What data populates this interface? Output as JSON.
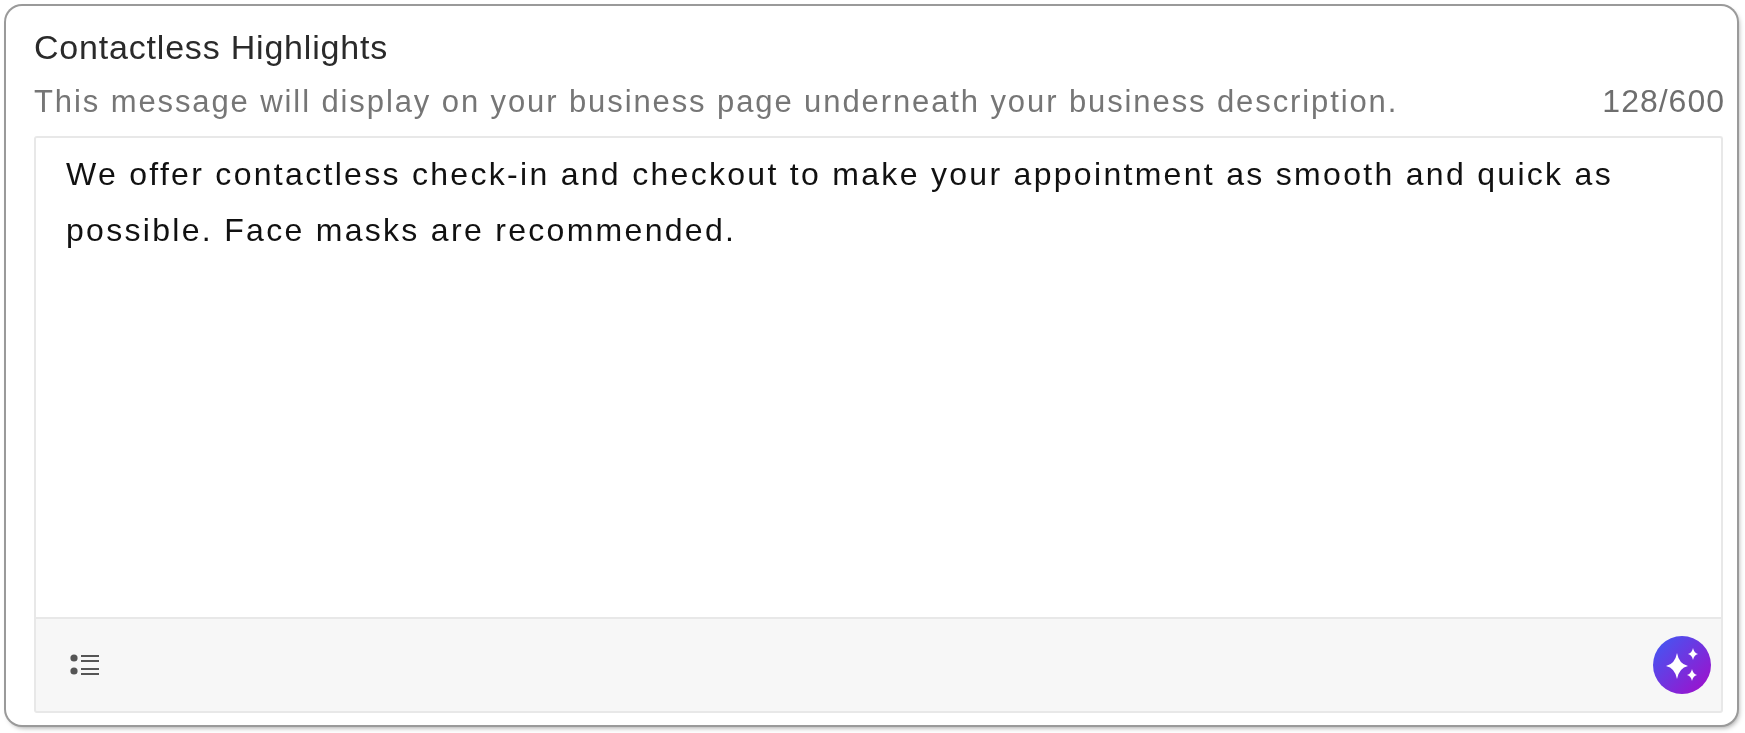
{
  "title": "Contactless Highlights",
  "description": "This message will display on your business page underneath your business description.",
  "counter": "128/600",
  "editor": {
    "value": "We offer contactless check-in and checkout to make your appointment as smooth and quick as possible. Face masks are recommended."
  }
}
